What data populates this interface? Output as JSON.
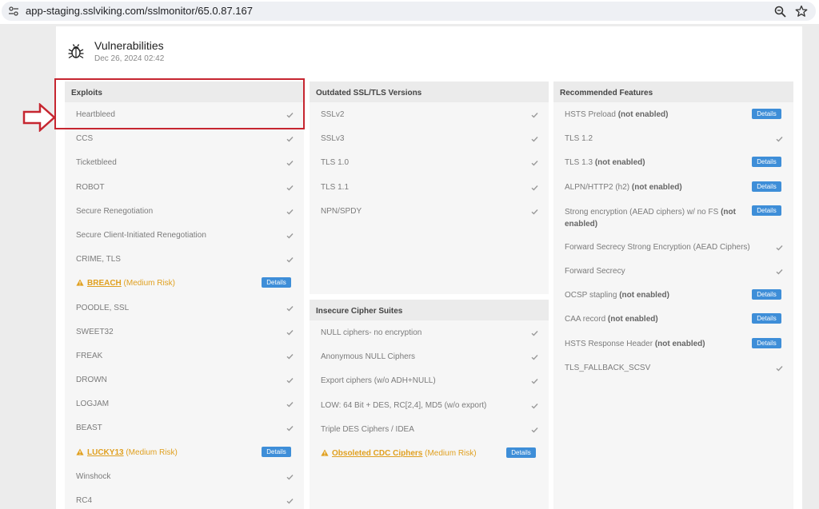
{
  "browser": {
    "url": "app-staging.sslviking.com/sslmonitor/65.0.87.167"
  },
  "header": {
    "title": "Vulnerabilities",
    "date": "Dec 26, 2024 02:42"
  },
  "details_label": "Details",
  "exploits": {
    "title": "Exploits",
    "items": [
      {
        "label": "Heartbleed"
      },
      {
        "label": "CCS"
      },
      {
        "label": "Ticketbleed"
      },
      {
        "label": "ROBOT"
      },
      {
        "label": "Secure Renegotiation"
      },
      {
        "label": "Secure Client-Initiated Renegotiation"
      },
      {
        "label": "CRIME, TLS"
      },
      {
        "link": "BREACH",
        "rest": " (Medium Risk)"
      },
      {
        "label": "POODLE, SSL"
      },
      {
        "label": "SWEET32"
      },
      {
        "label": "FREAK"
      },
      {
        "label": "DROWN"
      },
      {
        "label": "LOGJAM"
      },
      {
        "label": "BEAST"
      },
      {
        "link": "LUCKY13",
        "rest": " (Medium Risk)"
      },
      {
        "label": "Winshock"
      },
      {
        "label": "RC4"
      }
    ]
  },
  "outdated": {
    "title": "Outdated SSL/TLS Versions",
    "items": [
      {
        "label": "SSLv2"
      },
      {
        "label": "SSLv3"
      },
      {
        "label": "TLS 1.0"
      },
      {
        "label": "TLS 1.1"
      },
      {
        "label": "NPN/SPDY"
      }
    ]
  },
  "insecure": {
    "title": "Insecure Cipher Suites",
    "items": [
      {
        "label": "NULL ciphers- no encryption"
      },
      {
        "label": "Anonymous NULL Ciphers"
      },
      {
        "label": "Export ciphers (w/o ADH+NULL)"
      },
      {
        "label": "LOW: 64 Bit + DES, RC[2,4], MD5 (w/o export)"
      },
      {
        "label": "Triple DES Ciphers / IDEA"
      },
      {
        "link": "Obsoleted CDC Ciphers",
        "rest": " (Medium Risk)"
      }
    ]
  },
  "recommended": {
    "title": "Recommended Features",
    "items": [
      {
        "label": "HSTS Preload ",
        "bold": "(not enabled)"
      },
      {
        "label": "TLS 1.2"
      },
      {
        "label": "TLS 1.3 ",
        "bold": "(not enabled)"
      },
      {
        "label": "ALPN/HTTP2 (h2) ",
        "bold": "(not enabled)"
      },
      {
        "label": "Strong encryption (AEAD ciphers) w/ no FS ",
        "bold": "(not",
        "label2": "",
        "bold2": "enabled)"
      },
      {
        "label": "Forward Secrecy Strong Encryption (AEAD Ciphers)"
      },
      {
        "label": "Forward Secrecy"
      },
      {
        "label": "OCSP stapling ",
        "bold": "(not enabled)"
      },
      {
        "label": "CAA record ",
        "bold": "(not enabled)"
      },
      {
        "label": "HSTS Response Header ",
        "bold": "(not enabled)"
      },
      {
        "label": "TLS_FALLBACK_SCSV"
      }
    ]
  },
  "colors": {
    "accent_button": "#3e8ed8",
    "warning": "#e0a020",
    "highlight": "#c62630"
  }
}
